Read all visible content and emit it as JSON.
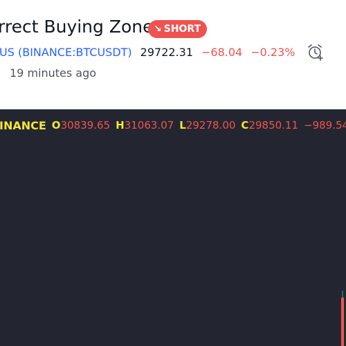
{
  "idea": {
    "title": "rrect Buying Zone",
    "badge": {
      "label": "SHORT",
      "icon": "arrow-down-right-icon",
      "color": "#ef5350"
    },
    "symbol_prefix": "US",
    "symbol_link": "(BINANCE:BTCUSDT)",
    "price": "29722.31",
    "change": "−68.04",
    "change_percent": "−0.23%",
    "time_ago": "19 minutes ago",
    "alarm_icon": "alarm-clock-plus-icon"
  },
  "chart": {
    "exchange_label": "INANCE",
    "ohlc": [
      {
        "label": "O",
        "value": "30839.65"
      },
      {
        "label": "H",
        "value": "31063.07"
      },
      {
        "label": "L",
        "value": "29278.00"
      },
      {
        "label": "C",
        "value": "29850.11"
      }
    ],
    "change": "−989.54 (",
    "colors": {
      "background": "#232630",
      "label": "#f5e43a",
      "value": "#ef5350"
    }
  }
}
